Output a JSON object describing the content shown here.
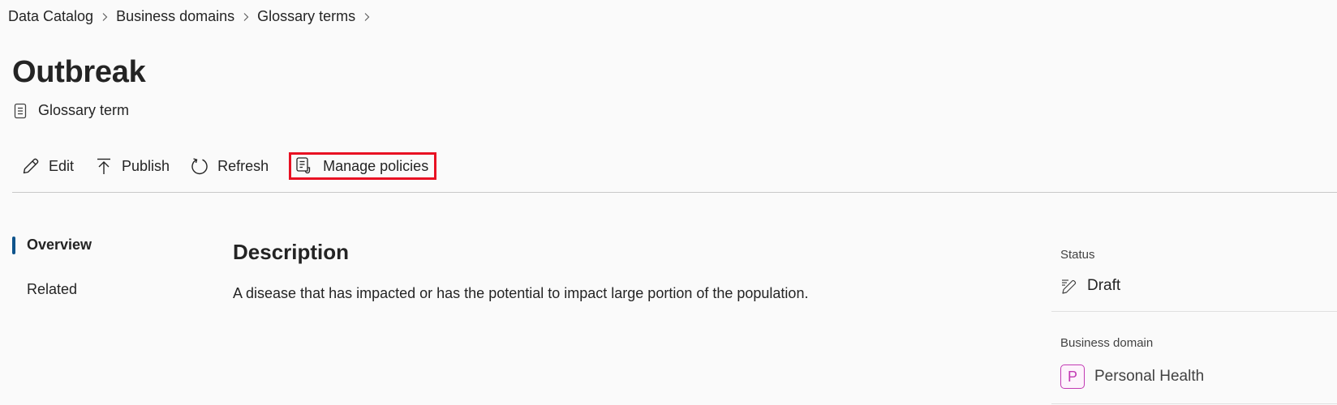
{
  "breadcrumb": {
    "items": [
      "Data Catalog",
      "Business domains",
      "Glossary terms"
    ],
    "separator_icon": "chevron-right-icon"
  },
  "header": {
    "title": "Outbreak",
    "type_label": "Glossary term",
    "type_icon": "document-icon"
  },
  "toolbar": {
    "edit_label": "Edit",
    "publish_label": "Publish",
    "refresh_label": "Refresh",
    "manage_policies_label": "Manage policies",
    "highlight_color": "#e81123"
  },
  "nav": {
    "items": [
      {
        "label": "Overview",
        "active": true
      },
      {
        "label": "Related",
        "active": false
      }
    ],
    "active_color": "#0f548c"
  },
  "main": {
    "description_title": "Description",
    "description_text": "A disease that has impacted or has the potential to impact large portion of the population."
  },
  "details": {
    "status_label": "Status",
    "status_value": "Draft",
    "status_icon": "draft-pencil-icon",
    "business_domain_label": "Business domain",
    "business_domain_initial": "P",
    "business_domain_value": "Personal Health",
    "business_domain_color": "#c239b3"
  }
}
